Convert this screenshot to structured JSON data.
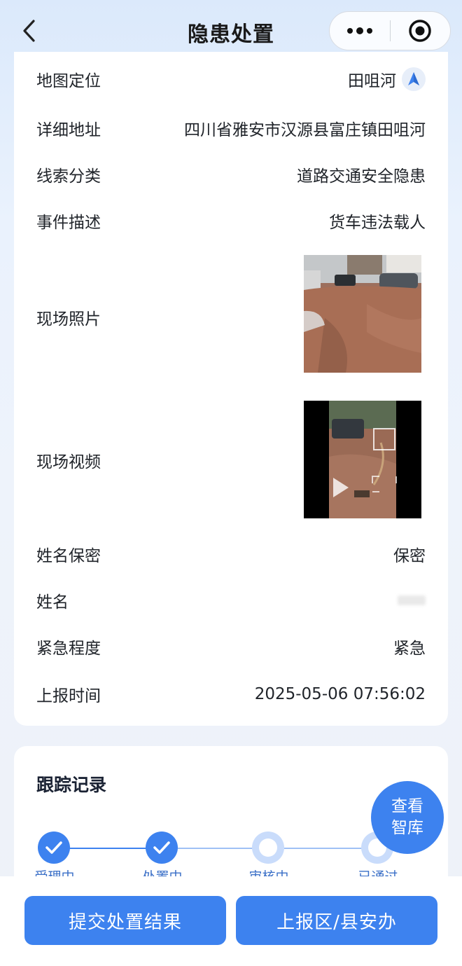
{
  "nav": {
    "title": "隐患处置",
    "back_icon": "chevron-left-icon",
    "more_icon": "more-dots-icon",
    "close_icon": "target-circle-icon"
  },
  "details": {
    "map_location": {
      "label": "地图定位",
      "value": "田咀河"
    },
    "address": {
      "label": "详细地址",
      "value": "四川省雅安市汉源县富庄镇田咀河"
    },
    "category": {
      "label": "线索分类",
      "value": "道路交通安全隐患"
    },
    "description": {
      "label": "事件描述",
      "value": "货车违法载人"
    },
    "photo": {
      "label": "现场照片"
    },
    "video": {
      "label": "现场视频"
    },
    "name_secret": {
      "label": "姓名保密",
      "value": "保密"
    },
    "name": {
      "label": "姓名"
    },
    "urgency": {
      "label": "紧急程度",
      "value": "紧急"
    },
    "report_time": {
      "label": "上报时间",
      "value": "2025-05-06 07:56:02"
    }
  },
  "tracking": {
    "title": "跟踪记录",
    "knowledge_button_line1": "查看",
    "knowledge_button_line2": "智库",
    "steps": [
      {
        "label": "受理中",
        "status": "done"
      },
      {
        "label": "处置中",
        "status": "done"
      },
      {
        "label": "审核中",
        "status": "pending"
      },
      {
        "label": "已通过",
        "status": "pending"
      }
    ]
  },
  "actions": {
    "submit_label": "提交处置结果",
    "report_label": "上报区/县安办"
  },
  "colors": {
    "primary": "#3d82ef",
    "step_pending": "#c9dcfb"
  }
}
